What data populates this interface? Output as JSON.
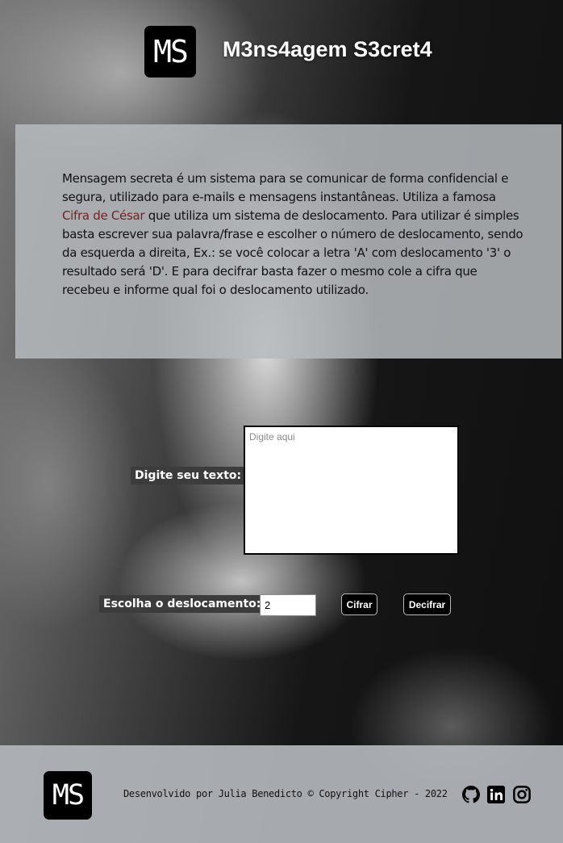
{
  "header": {
    "logo_text": "MS",
    "title": "M3ns4agem S3cret4"
  },
  "intro": {
    "text_before_link": "Mensagem secreta é um sistema para se comunicar de forma confidencial e segura, utilizado para e-mails e mensagens instantâneas. Utiliza a famosa ",
    "link_text": "Cifra de César",
    "text_after_link": " que utiliza um sistema de deslocamento. Para utilizar é simples basta escrever sua palavra/frase e escolher o número de deslocamento, sendo da esquerda a direita, Ex.: se você colocar a letra 'A' com deslocamento '3' o resultado será 'D'. E para decifrar basta fazer o mesmo cole a cifra que recebeu e informe qual foi o deslocamento utilizado."
  },
  "form": {
    "text_label": "Digite seu texto:",
    "text_placeholder": "Digite aqui",
    "shift_label": "Escolha o deslocamento:",
    "shift_value": "2",
    "encrypt_label": "Cifrar",
    "decrypt_label": "Decifrar"
  },
  "footer": {
    "logo_text": "MS",
    "credit": "Desenvolvido por Julia Benedicto © Copyright Cipher - 2022",
    "social": [
      "github-icon",
      "linkedin-icon",
      "instagram-icon"
    ]
  },
  "colors": {
    "panel": "#b6babe",
    "link": "#7a1e1e",
    "label_chip": "#3c3c3c",
    "button": "#000000"
  }
}
